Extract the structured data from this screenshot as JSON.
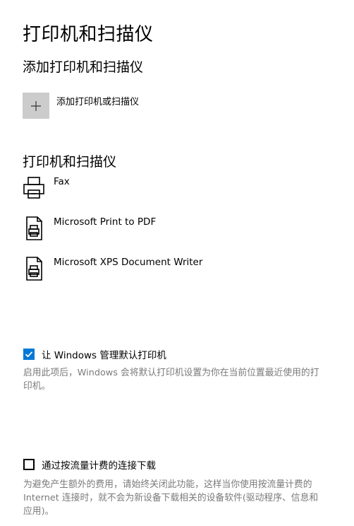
{
  "page": {
    "title": "打印机和扫描仪"
  },
  "add_section": {
    "heading": "添加打印机和扫描仪",
    "add_button_label": "添加打印机或扫描仪"
  },
  "devices_section": {
    "heading": "打印机和扫描仪",
    "devices": [
      {
        "name": "Fax",
        "icon": "fax-icon"
      },
      {
        "name": "Microsoft Print to PDF",
        "icon": "printer-doc-icon"
      },
      {
        "name": "Microsoft XPS Document Writer",
        "icon": "printer-doc-icon"
      }
    ]
  },
  "default_printer": {
    "checked": true,
    "label": "让 Windows 管理默认打印机",
    "description": "启用此项后，Windows 会将默认打印机设置为你在当前位置最近使用的打印机。"
  },
  "metered": {
    "checked": false,
    "label": "通过按流量计费的连接下载",
    "description": "为避免产生额外的费用，请始终关闭此功能，这样当你使用按流量计费的 Internet 连接时，就不会为新设备下载相关的设备软件(驱动程序、信息和应用)。"
  },
  "colors": {
    "accent": "#0078d7",
    "add_button_bg": "#cccccc",
    "secondary_text": "#7a7a7a"
  }
}
